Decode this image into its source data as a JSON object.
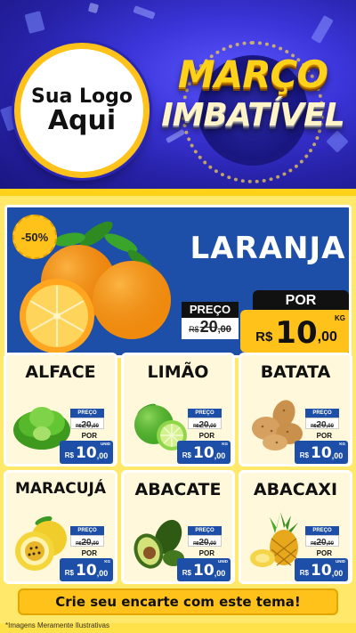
{
  "header": {
    "logo_line1": "Sua Logo",
    "logo_line2": "Aqui",
    "title_line1": "MARÇO",
    "title_line2": "IMBATÍVEL"
  },
  "featured": {
    "discount_badge": "-50%",
    "name": "LARANJA",
    "old_label": "PREÇO",
    "old_currency": "R$",
    "old_int": "20",
    "old_dec": ",00",
    "new_label": "POR",
    "new_currency": "R$",
    "new_int": "10",
    "new_dec": ",00",
    "unit": "KG"
  },
  "products": [
    {
      "name": "ALFACE",
      "old_label": "PREÇO",
      "old_currency": "R$",
      "old_int": "20",
      "old_dec": ",00",
      "new_label": "POR",
      "new_currency": "R$",
      "new_int": "10",
      "new_dec": ",00",
      "unit": "UNID",
      "icon": "lettuce-icon"
    },
    {
      "name": "LIMÃO",
      "old_label": "PREÇO",
      "old_currency": "R$",
      "old_int": "20",
      "old_dec": ",00",
      "new_label": "POR",
      "new_currency": "R$",
      "new_int": "10",
      "new_dec": ",00",
      "unit": "KG",
      "icon": "lime-icon"
    },
    {
      "name": "BATATA",
      "old_label": "PREÇO",
      "old_currency": "R$",
      "old_int": "20",
      "old_dec": ",00",
      "new_label": "POR",
      "new_currency": "R$",
      "new_int": "10",
      "new_dec": ",00",
      "unit": "KG",
      "icon": "potato-icon"
    },
    {
      "name": "MARACUJÁ",
      "old_label": "PREÇO",
      "old_currency": "R$",
      "old_int": "20",
      "old_dec": ",00",
      "new_label": "POR",
      "new_currency": "R$",
      "new_int": "10",
      "new_dec": ",00",
      "unit": "KG",
      "icon": "passion-fruit-icon"
    },
    {
      "name": "ABACATE",
      "old_label": "PREÇO",
      "old_currency": "R$",
      "old_int": "20",
      "old_dec": ",00",
      "new_label": "POR",
      "new_currency": "R$",
      "new_int": "10",
      "new_dec": ",00",
      "unit": "UNID",
      "icon": "avocado-icon"
    },
    {
      "name": "ABACAXI",
      "old_label": "PREÇO",
      "old_currency": "R$",
      "old_int": "20",
      "old_dec": ",00",
      "new_label": "POR",
      "new_currency": "R$",
      "new_int": "10",
      "new_dec": ",00",
      "unit": "UNID",
      "icon": "pineapple-icon"
    }
  ],
  "cta_text": "Crie seu encarte com este tema!",
  "footnote": "*Imagens Meramente Ilustrativas",
  "colors": {
    "header_blue": "#3b34d8",
    "price_blue": "#1d4fa8",
    "accent_yellow": "#ffc21a",
    "board_yellow": "#ffe14a"
  }
}
